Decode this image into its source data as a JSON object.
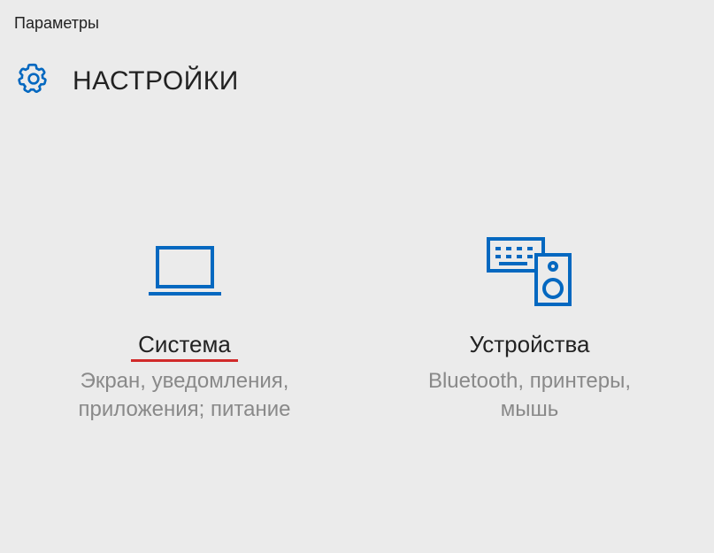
{
  "window": {
    "title": "Параметры"
  },
  "header": {
    "title": "НАСТРОЙКИ"
  },
  "tiles": {
    "system": {
      "title": "Система",
      "description": "Экран, уведомления, приложения; питание"
    },
    "devices": {
      "title": "Устройства",
      "description": "Bluetooth, принтеры, мышь"
    }
  }
}
